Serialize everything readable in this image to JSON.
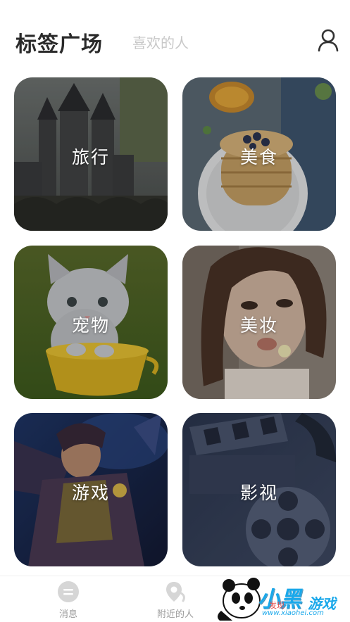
{
  "header": {
    "active_tab": "标签广场",
    "inactive_tab": "喜欢的人",
    "profile_icon": "user-icon"
  },
  "tags": [
    {
      "label": "旅行",
      "image": "castle-photo"
    },
    {
      "label": "美食",
      "image": "pancakes-photo"
    },
    {
      "label": "宠物",
      "image": "kitten-photo"
    },
    {
      "label": "美妆",
      "image": "woman-portrait-photo"
    },
    {
      "label": "游戏",
      "image": "game-hero-artwork"
    },
    {
      "label": "影视",
      "image": "film-reel-photo"
    }
  ],
  "bottom_nav": {
    "messages": {
      "label": "消息",
      "icon": "chat-bubble-icon"
    },
    "nearby": {
      "label": "附近的人",
      "icon": "location-pin-icon"
    }
  },
  "watermark": {
    "brand": "小黑",
    "game": "游戏",
    "faxian": "发现",
    "site": "www.xiaohei.com",
    "mascot": "panda-icon"
  },
  "colors": {
    "title": "#2a2a2a",
    "inactive_tab": "#c8c8c8",
    "nav_label": "#9a9a9a",
    "watermark_blue": "#1aa8ea"
  }
}
